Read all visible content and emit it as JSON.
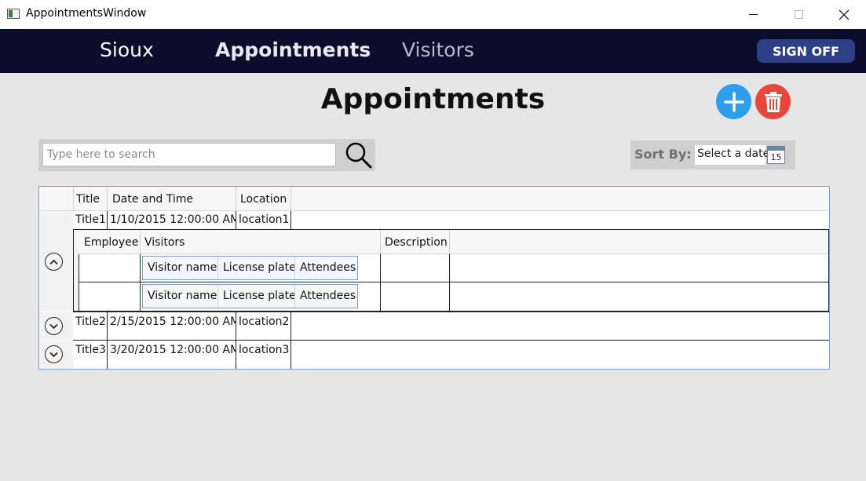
{
  "window": {
    "title": "AppointmentsWindow"
  },
  "nav": {
    "items": [
      "Sioux",
      "Appointments",
      "Visitors"
    ],
    "sign_off": "SIGN OFF"
  },
  "page": {
    "title": "Appointments"
  },
  "search": {
    "placeholder": "Type here to search",
    "value": ""
  },
  "sort": {
    "label": "Sort By:",
    "date_placeholder": "Select a date",
    "calendar_day": "15"
  },
  "grid": {
    "columns": [
      "Title",
      "Date and Time",
      "Location"
    ],
    "rows": [
      {
        "title": "Title1",
        "datetime": "1/10/2015 12:00:00 AM",
        "location": "location1",
        "expanded": true
      },
      {
        "title": "Title2",
        "datetime": "2/15/2015 12:00:00 AM",
        "location": "location2",
        "expanded": false
      },
      {
        "title": "Title3",
        "datetime": "3/20/2015 12:00:00 AM",
        "location": "location3",
        "expanded": false
      }
    ],
    "detail": {
      "columns": [
        "Employee",
        "Visitors",
        "Description"
      ],
      "visitor_columns": [
        "Visitor name",
        "License plate",
        "Attendees"
      ],
      "rows": 2
    }
  },
  "colors": {
    "nav_bg": "#0c0c2c",
    "sign_off_bg": "#2d3f86",
    "add_button": "#2f9ee8",
    "delete_button": "#e8463a",
    "grid_border": "#7aa0c8"
  },
  "icons": {
    "add": "plus-icon",
    "delete": "trash-icon",
    "search": "magnifier-icon",
    "calendar": "calendar-icon",
    "collapse": "chevron-up-icon",
    "expand": "chevron-down-icon"
  }
}
